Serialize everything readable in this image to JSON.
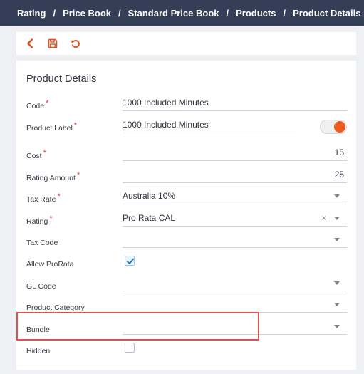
{
  "breadcrumb": [
    "Rating",
    "Price Book",
    "Standard Price Book",
    "Products",
    "Product Details"
  ],
  "toolbar": {
    "back_icon": "chevron-left-icon",
    "save_icon": "save-icon",
    "reset_icon": "undo-icon",
    "accent": "#e0521f"
  },
  "card": {
    "title": "Product Details"
  },
  "fields": {
    "code": {
      "label": "Code",
      "value": "1000 Included Minutes",
      "required": "*"
    },
    "product_label": {
      "label": "Product Label",
      "value": "1000 Included Minutes",
      "required": "*",
      "toggle_on": true
    },
    "cost": {
      "label": "Cost",
      "value": "15",
      "required": "*"
    },
    "rating_amount": {
      "label": "Rating Amount",
      "value": "25",
      "required": "*"
    },
    "tax_rate": {
      "label": "Tax Rate",
      "value": "Australia 10%",
      "required": "*"
    },
    "rating": {
      "label": "Rating",
      "value": "Pro Rata CAL",
      "required": "*",
      "clear": "×"
    },
    "tax_code": {
      "label": "Tax Code",
      "value": ""
    },
    "allow_prorata": {
      "label": "Allow ProRata",
      "checked": true
    },
    "gl_code": {
      "label": "GL Code",
      "value": ""
    },
    "product_category": {
      "label": "Product Category",
      "value": ""
    },
    "bundle": {
      "label": "Bundle",
      "value": ""
    },
    "hidden": {
      "label": "Hidden",
      "checked": false
    }
  },
  "colors": {
    "header_bg": "#343e56",
    "required": "#e0343a",
    "toggle_knob": "#ef5a1f",
    "highlight": "#d9534f"
  }
}
